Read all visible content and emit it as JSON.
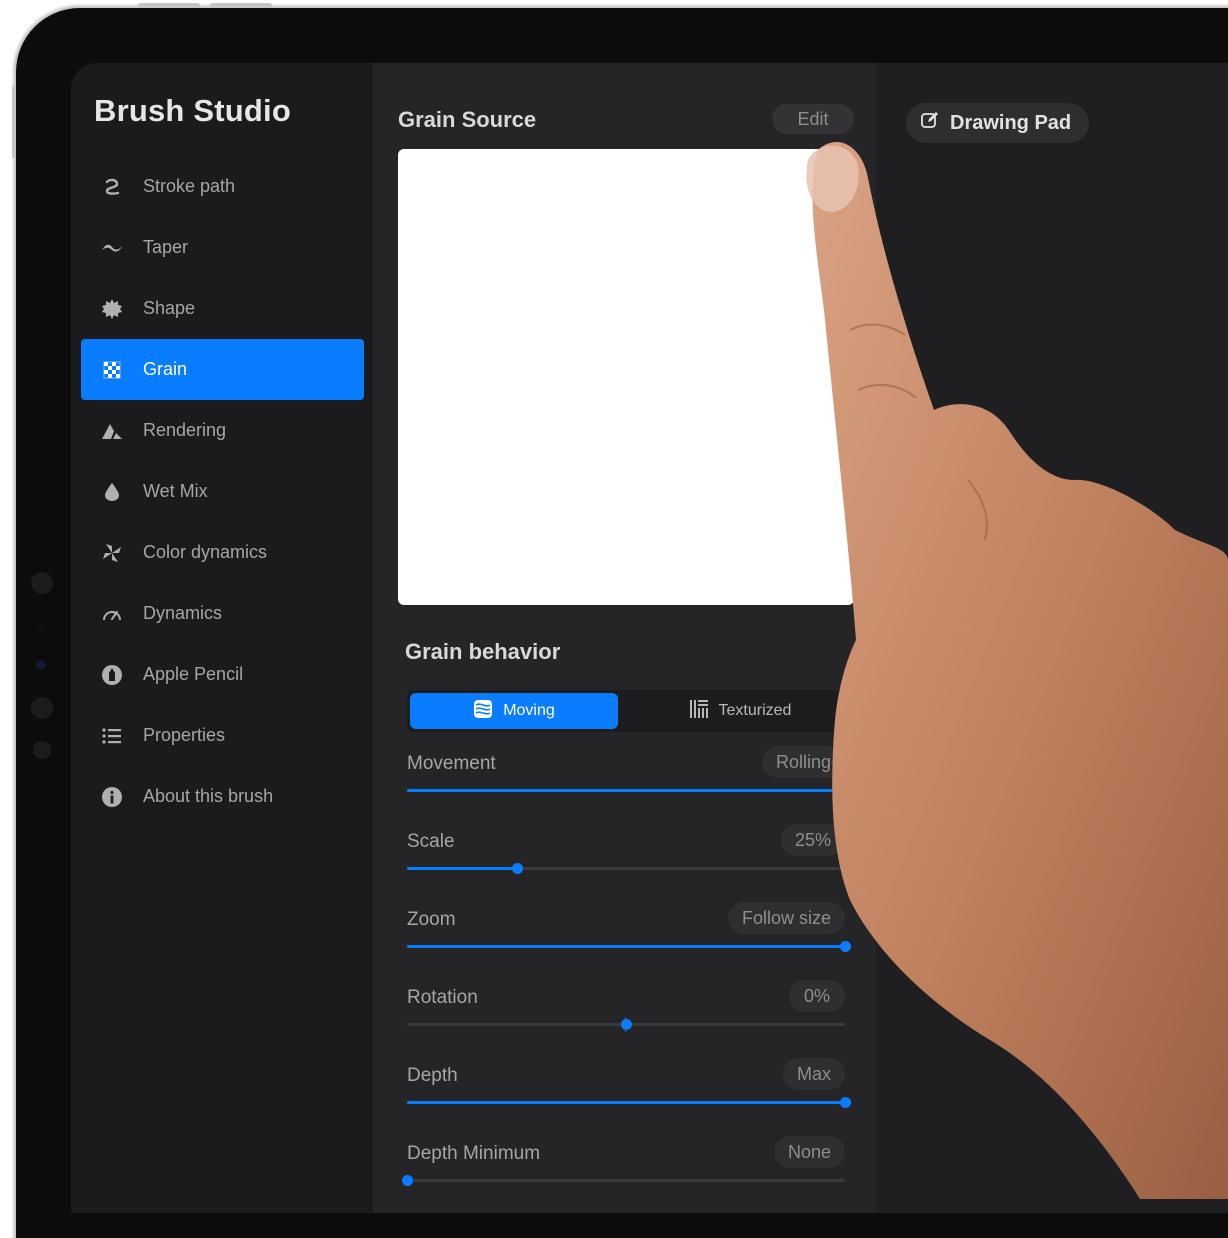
{
  "app": {
    "title": "Brush Studio"
  },
  "sidebar": {
    "items": [
      {
        "label": "Stroke path",
        "icon": "stroke-path-icon"
      },
      {
        "label": "Taper",
        "icon": "taper-icon"
      },
      {
        "label": "Shape",
        "icon": "shape-icon"
      },
      {
        "label": "Grain",
        "icon": "grain-icon",
        "active": true
      },
      {
        "label": "Rendering",
        "icon": "rendering-icon"
      },
      {
        "label": "Wet Mix",
        "icon": "wet-mix-icon"
      },
      {
        "label": "Color dynamics",
        "icon": "color-dynamics-icon"
      },
      {
        "label": "Dynamics",
        "icon": "dynamics-icon"
      },
      {
        "label": "Apple Pencil",
        "icon": "apple-pencil-icon"
      },
      {
        "label": "Properties",
        "icon": "properties-icon"
      },
      {
        "label": "About this brush",
        "icon": "info-icon"
      }
    ]
  },
  "grain_source": {
    "title": "Grain Source",
    "edit_label": "Edit"
  },
  "grain_behavior": {
    "title": "Grain behavior",
    "modes": [
      {
        "label": "Moving",
        "icon": "moving-icon",
        "active": true
      },
      {
        "label": "Texturized",
        "icon": "texturized-icon",
        "active": false
      }
    ]
  },
  "settings": [
    {
      "label": "Movement",
      "value": "Rolling",
      "fraction": 1.0
    },
    {
      "label": "Scale",
      "value": "25%",
      "fraction": 0.25
    },
    {
      "label": "Zoom",
      "value": "Follow size",
      "fraction": 1.0
    },
    {
      "label": "Rotation",
      "value": "0%",
      "fraction": 0.5,
      "centered": true
    },
    {
      "label": "Depth",
      "value": "Max",
      "fraction": 1.0
    },
    {
      "label": "Depth Minimum",
      "value": "None",
      "fraction": 0.0
    }
  ],
  "drawing_pad": {
    "label": "Drawing Pad",
    "icon": "edit-square-icon"
  },
  "colors": {
    "accent": "#0a7cff",
    "sidebar_bg": "#1b1b1d",
    "panel_bg": "#252527",
    "canvas_bg": "#1f1f21",
    "skin": "#c98a6a"
  }
}
